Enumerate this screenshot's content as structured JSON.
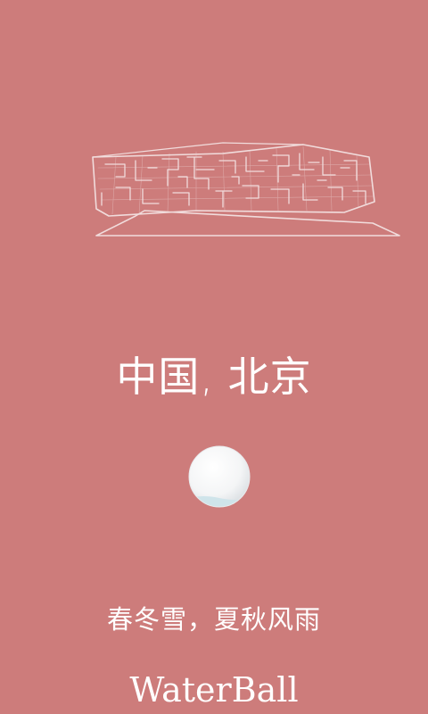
{
  "colors": {
    "background": "#cd7c7b",
    "line": "#f1dcdc",
    "text": "#ffffff",
    "ball_water": "#cfe4ea"
  },
  "illustration": {
    "icon": "building-outline-icon"
  },
  "location": {
    "city": "中国, 北京"
  },
  "ball": {
    "icon": "water-ball-icon"
  },
  "weather": {
    "description": "春冬雪，夏秋风雨"
  },
  "app": {
    "name": "WaterBall"
  }
}
